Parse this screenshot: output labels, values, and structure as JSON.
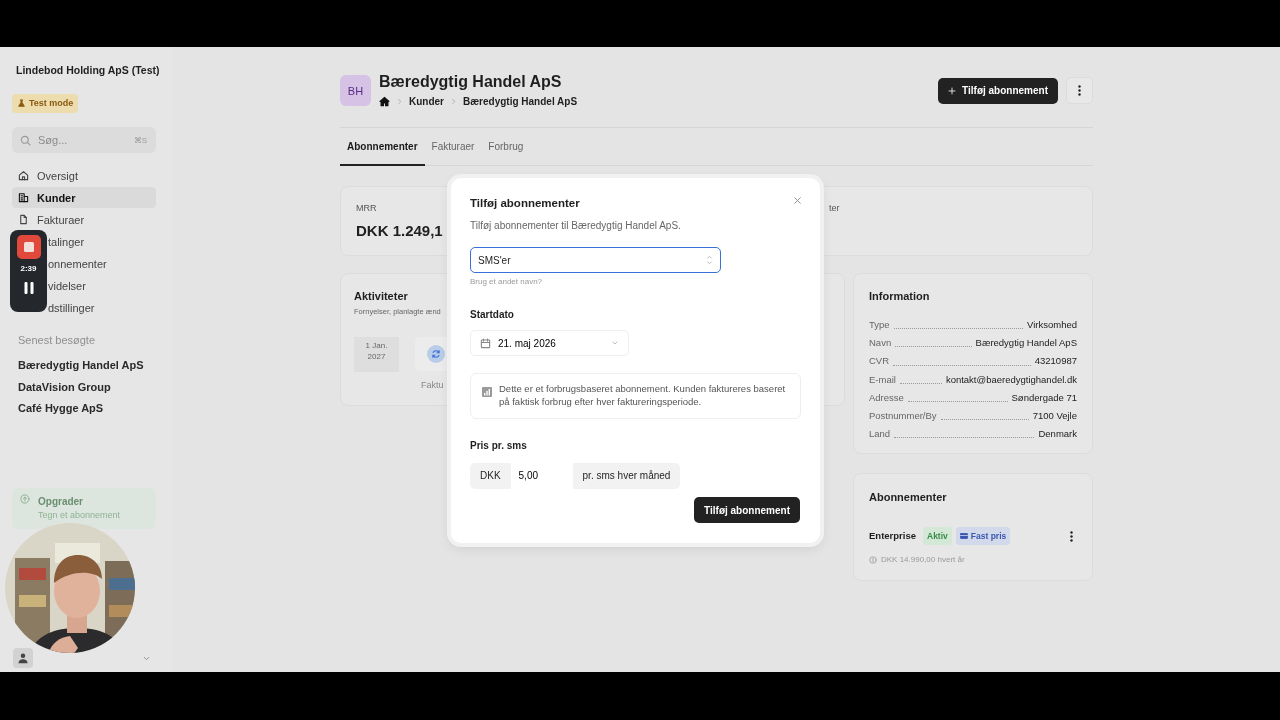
{
  "sidebar": {
    "org": "Lindebod Holding ApS (Test)",
    "mode_badge": "Test mode",
    "search": {
      "placeholder": "Søg...",
      "shortcut": "⌘S"
    },
    "nav": [
      {
        "label": "Oversigt",
        "selected": false,
        "kind": "full"
      },
      {
        "label": "Kunder",
        "selected": true,
        "kind": "full"
      },
      {
        "label": "Fakturaer",
        "selected": false,
        "kind": "full"
      },
      {
        "label": "talinger",
        "selected": false,
        "kind": "covered"
      },
      {
        "label": "onnementer",
        "selected": false,
        "kind": "covered"
      },
      {
        "label": "videlser",
        "selected": false,
        "kind": "covered"
      },
      {
        "label": "dstillinger",
        "selected": false,
        "kind": "covered"
      }
    ],
    "recent_label": "Senest besøgte",
    "recent": [
      "Bæredygtig Handel ApS",
      "DataVision Group",
      "Café Hygge ApS"
    ],
    "upgrade": {
      "title": "Opgrader",
      "subtitle": "Tegn et abonnement"
    }
  },
  "recorder": {
    "time": "2:39"
  },
  "header": {
    "initials": "BH",
    "title": "Bæredygtig Handel ApS",
    "breadcrumb": [
      "Kunder",
      "Bæredygtig Handel ApS"
    ],
    "primary_button": "Tilføj abonnement"
  },
  "tabs": [
    {
      "label": "Abonnementer",
      "selected": true
    },
    {
      "label": "Fakturaer",
      "selected": false
    },
    {
      "label": "Forbrug",
      "selected": false
    }
  ],
  "stats": [
    {
      "label": "MRR",
      "value": "DKK 1.249,1"
    },
    {
      "label": "ter"
    }
  ],
  "activities": {
    "title": "Aktiviteter",
    "subtitle": "Fornyelser, planlagte ænd",
    "date": [
      "1 Jan.",
      "2027"
    ],
    "event_label": "Faktu"
  },
  "information": {
    "title": "Information",
    "rows": [
      {
        "label": "Type",
        "value": "Virksomhed"
      },
      {
        "label": "Navn",
        "value": "Bæredygtig Handel ApS"
      },
      {
        "label": "CVR",
        "value": "43210987"
      },
      {
        "label": "E-mail",
        "value": "kontakt@baeredygtighandel.dk"
      },
      {
        "label": "Adresse",
        "value": "Søndergade 71"
      },
      {
        "label": "Postnummer/By",
        "value": "7100 Vejle"
      },
      {
        "label": "Land",
        "value": "Denmark"
      }
    ]
  },
  "subscriptions": {
    "title": "Abonnementer",
    "items": [
      {
        "name": "Enterprise",
        "badges": [
          {
            "label": "Aktiv",
            "kind": "status"
          },
          {
            "label": "Fast pris",
            "kind": "pricing"
          }
        ],
        "price": "DKK 14.990,00 hvert år"
      }
    ]
  },
  "modal": {
    "title": "Tilføj abonnementer",
    "subtitle": "Tilføj abonnementer til Bæredygtig Handel ApS.",
    "name_value": "SMS'er",
    "name_hint": "Brug et andet navn?",
    "start_label": "Startdato",
    "start_value": "21. maj 2026",
    "info_text": "Dette er et forbrugsbaseret abonnement. Kunden faktureres baseret på faktisk forbrug efter hver faktureringsperiode.",
    "price_label": "Pris pr. sms",
    "currency": "DKK",
    "price_value": "5,00",
    "unit": "pr. sms hver måned",
    "submit": "Tilføj abonnement"
  }
}
